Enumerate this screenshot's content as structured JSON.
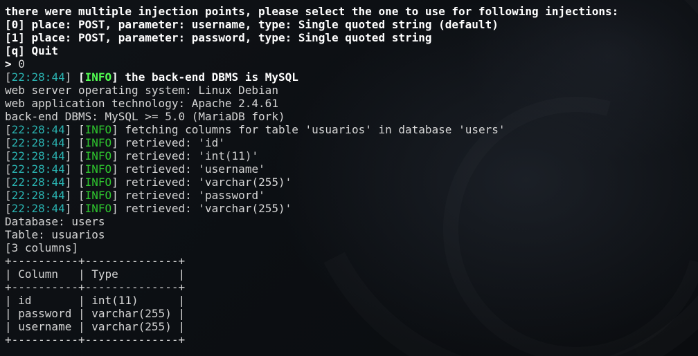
{
  "lines": [
    {
      "id": "sep",
      "text": "---"
    },
    {
      "id": "question",
      "text": "there were multiple injection points, please select the one to use for following injections:"
    },
    {
      "id": "opt0",
      "text": "[0] place: POST, parameter: username, type: Single quoted string (default)"
    },
    {
      "id": "opt1",
      "text": "[1] place: POST, parameter: password, type: Single quoted string"
    },
    {
      "id": "optq",
      "text": "[q] Quit"
    },
    {
      "id": "answer",
      "prompt": ">",
      "value": "0"
    }
  ],
  "log": [
    {
      "time": "22:28:44",
      "level": "INFO",
      "message": "the back-end DBMS is MySQL",
      "bold": true
    },
    {
      "plain": "web server operating system: Linux Debian"
    },
    {
      "plain": "web application technology: Apache 2.4.61"
    },
    {
      "plain": "back-end DBMS: MySQL >= 5.0 (MariaDB fork)"
    },
    {
      "time": "22:28:44",
      "level": "INFO",
      "message": "fetching columns for table 'usuarios' in database 'users'"
    },
    {
      "time": "22:28:44",
      "level": "INFO",
      "message": "retrieved: 'id'"
    },
    {
      "time": "22:28:44",
      "level": "INFO",
      "message": "retrieved: 'int(11)'"
    },
    {
      "time": "22:28:44",
      "level": "INFO",
      "message": "retrieved: 'username'"
    },
    {
      "time": "22:28:44",
      "level": "INFO",
      "message": "retrieved: 'varchar(255)'"
    },
    {
      "time": "22:28:44",
      "level": "INFO",
      "message": "retrieved: 'password'"
    },
    {
      "time": "22:28:44",
      "level": "INFO",
      "message": "retrieved: 'varchar(255)'"
    }
  ],
  "result": {
    "database_line": "Database: users",
    "table_line": "Table: usuarios",
    "count_line": "[3 columns]",
    "table_border": "+----------+--------------+",
    "header": "| Column   | Type         |",
    "rows": [
      "| id       | int(11)      |",
      "| password | varchar(255) |",
      "| username | varchar(255) |"
    ]
  },
  "colors": {
    "timestamp": "#2ab3b1",
    "info_tag": "#2ec52e",
    "info_tag_bold": "#52ff52",
    "text": "#d6d6d6",
    "bold_text": "#ffffff",
    "background": "#0b0d10"
  }
}
